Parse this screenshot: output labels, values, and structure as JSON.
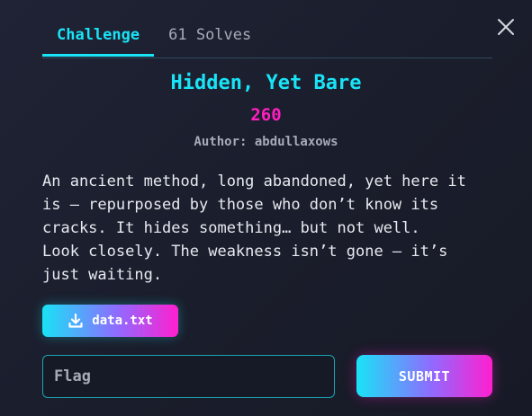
{
  "colors": {
    "accent_cyan": "#19e3f6",
    "accent_magenta": "#ff1fbf",
    "text_muted": "#a6abb8",
    "background": "#1b1f2e"
  },
  "tabs": [
    {
      "label": "Challenge",
      "active": true
    },
    {
      "label": "61 Solves",
      "active": false
    }
  ],
  "close_icon": "close-icon",
  "challenge": {
    "title": "Hidden, Yet Bare",
    "points": "260",
    "author": "Author: abdullaxows",
    "description": "An ancient method, long abandoned, yet here it\nis — repurposed by those who don’t know its\ncracks. It hides something… but not well.\nLook closely. The weakness isn’t gone — it’s\njust waiting."
  },
  "file": {
    "icon": "download-icon",
    "name": "data.txt"
  },
  "form": {
    "flag_placeholder": "Flag",
    "flag_value": "",
    "submit_label": "SUBMIT"
  }
}
